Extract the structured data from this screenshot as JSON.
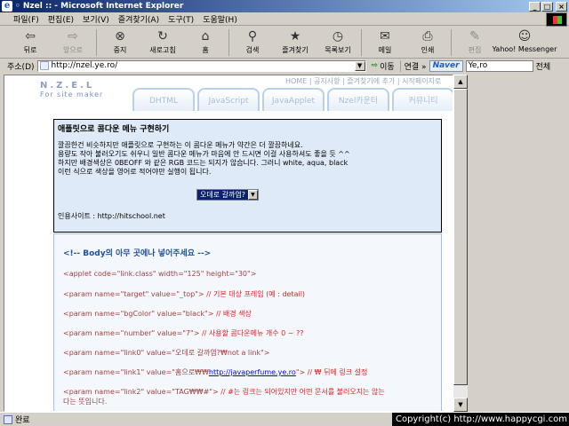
{
  "window": {
    "title": "◦ Nzel :: - Microsoft Internet Explorer",
    "min": "_",
    "max": "□",
    "close": "×"
  },
  "menu": [
    "파일(F)",
    "편집(E)",
    "보기(V)",
    "즐겨찾기(A)",
    "도구(T)",
    "도움말(H)"
  ],
  "toolbar": [
    {
      "label": "뒤로",
      "icon": "⇦",
      "name": "back-button",
      "disabled": false
    },
    {
      "label": "앞으로",
      "icon": "⇨",
      "name": "forward-button",
      "disabled": true
    },
    {
      "label": "중지",
      "icon": "⊗",
      "name": "stop-button",
      "disabled": false
    },
    {
      "label": "새로고침",
      "icon": "↻",
      "name": "refresh-button",
      "disabled": false
    },
    {
      "label": "홈",
      "icon": "⌂",
      "name": "home-button",
      "disabled": false
    },
    {
      "label": "검색",
      "icon": "⚲",
      "name": "search-button",
      "disabled": false
    },
    {
      "label": "즐겨찾기",
      "icon": "★",
      "name": "favorites-button",
      "disabled": false
    },
    {
      "label": "목록보기",
      "icon": "◷",
      "name": "history-button",
      "disabled": false
    },
    {
      "label": "메일",
      "icon": "✉",
      "name": "mail-button",
      "disabled": false
    },
    {
      "label": "인쇄",
      "icon": "⎙",
      "name": "print-button",
      "disabled": false
    },
    {
      "label": "편집",
      "icon": "✎",
      "name": "edit-button",
      "disabled": true
    },
    {
      "label": "Yahoo! Messenger",
      "icon": "☺",
      "name": "messenger-button",
      "disabled": false
    }
  ],
  "address": {
    "label": "주소(D)",
    "url": "http://nzel.ye.ro/",
    "go": "이동",
    "links": "연결 »"
  },
  "naver": {
    "logo": "Naver",
    "query": "Ye,ro",
    "all": "전체"
  },
  "site": {
    "logo_title": "N.Z.E.L",
    "logo_sub": "For site maker",
    "toplinks": "HOME | 공지사항 | 즐겨찾기에 추가 | 시작페이지로",
    "tabs": [
      "DHTML",
      "JavaScript",
      "JavaApplet",
      "Nzel카운터",
      "커뮤니티"
    ]
  },
  "box1": {
    "title": "애플릿으로 콤다운 메뉴 구현하기",
    "lines": [
      "깔끔한건 비슷하지만 애플릿으로 구현하는 이 콤다운 메뉴가 약간은 더 깔끔하네요.",
      "용량도 작아 불러오기도 쉬우니 일반 콤다운 메뉴가 마음에 안 드시면 이걸 사용하셔도 좋을 듯 ^^",
      "하지만 배경색상은 0BEOFF 와 같은 RGB 코드는 되지가 않습니다. 그러니 white, aqua, black",
      "이런 식으로 색상을 영어로 적어야만 실행이 됩니다."
    ],
    "select_value": "오데로 갈까염?",
    "reference": "인용사이트 : http://hitschool.net"
  },
  "code": {
    "comment": "<!-- Body의 아무 곳에나 넣어주세요 -->",
    "applet": "<applet code=\"link.class\" width=\"125\" height=\"30\">",
    "p1": {
      "code": "<param name=\"target\" value=\"_top\">",
      "note": " // 기본 대상 프레임 (예 : detail)"
    },
    "p2": {
      "code": "<param name=\"bgColor\" value=\"black\">",
      "note": " // 배경 색상"
    },
    "p3": {
      "code": "<param name=\"number\" value=\"7\">",
      "note": " // 사용할 콤다운메뉴 개수 0 ~ ??"
    },
    "p4": {
      "code": "<param name=\"link0\" value=\"오데로 갈까염?₩not a link\">"
    },
    "p5": {
      "code_pre": "<param name=\"link1\" value=\"홈으로₩₩",
      "url": "http://javaperfume.ye.ro",
      "code_post": "\">",
      "note": " // ₩ 뒤에 링크 설정"
    },
    "p6": {
      "code": "<param name=\"link2\" value=\"TAG₩₩#\">",
      "note": " // #는 링크는 되어있지만 어떤 문서를 불러오지는 않는",
      "note2": "다는 뜻입니다."
    }
  },
  "status": {
    "text": "완료",
    "copyright": "Copyright(c) http://www.happycgi.com"
  }
}
